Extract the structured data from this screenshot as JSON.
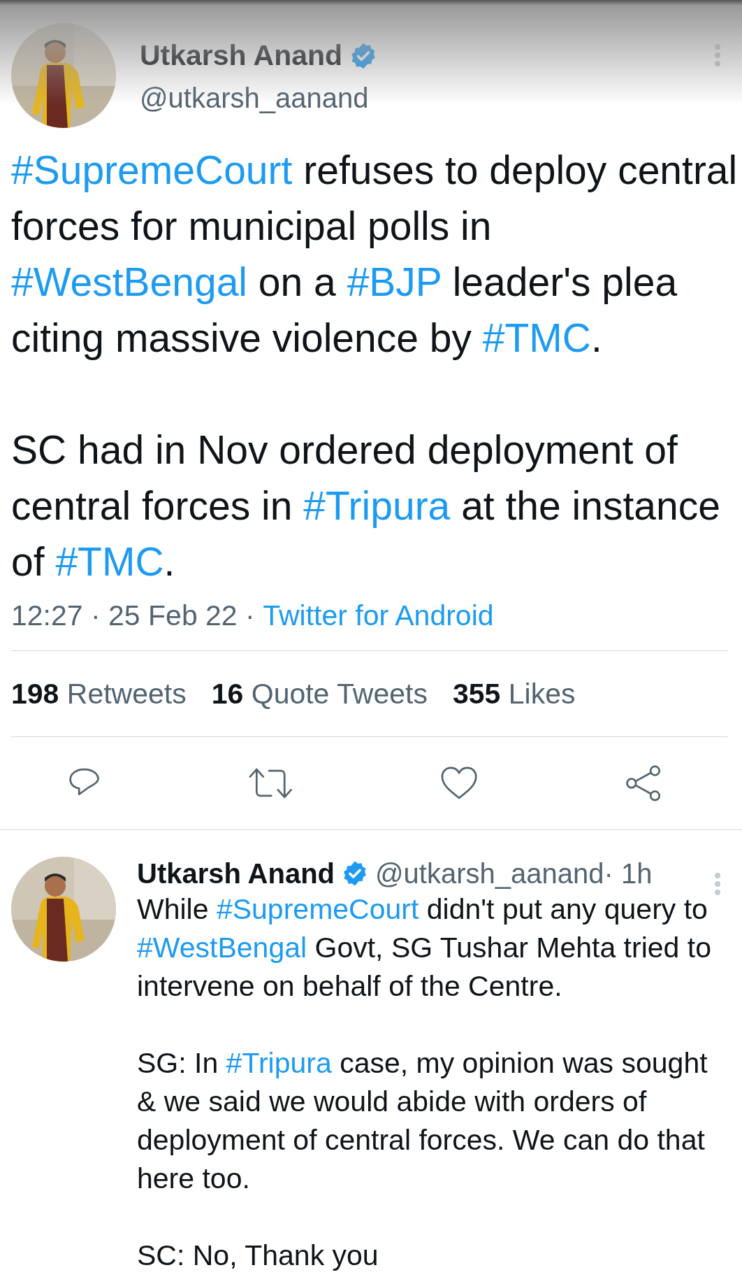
{
  "tweet": {
    "author": {
      "name": "Utkarsh Anand",
      "verified": true,
      "handle": "@utkarsh_aanand"
    },
    "paragraphs": [
      [
        {
          "kind": "hashtag",
          "text": "#SupremeCourt"
        },
        {
          "kind": "plain",
          "text": " refuses to deploy central forces for municipal polls in "
        },
        {
          "kind": "hashtag",
          "text": "#WestBengal"
        },
        {
          "kind": "plain",
          "text": " on a "
        },
        {
          "kind": "hashtag",
          "text": "#BJP"
        },
        {
          "kind": "plain",
          "text": " leader's plea citing massive violence by "
        },
        {
          "kind": "hashtag",
          "text": "#TMC"
        },
        {
          "kind": "plain",
          "text": "."
        }
      ],
      [
        {
          "kind": "plain",
          "text": "SC had in Nov ordered deployment of central forces in "
        },
        {
          "kind": "hashtag",
          "text": "#Tripura"
        },
        {
          "kind": "plain",
          "text": " at the instance of "
        },
        {
          "kind": "hashtag",
          "text": "#TMC"
        },
        {
          "kind": "plain",
          "text": "."
        }
      ]
    ],
    "time": "12:27 · 25 Feb 22 · ",
    "source": "Twitter for Android",
    "stats": [
      {
        "count": "198",
        "label": "Retweets"
      },
      {
        "count": "16",
        "label": "Quote Tweets"
      },
      {
        "count": "355",
        "label": "Likes"
      }
    ],
    "actions": [
      {
        "kind": "reply"
      },
      {
        "kind": "retweet"
      },
      {
        "kind": "like"
      },
      {
        "kind": "share"
      }
    ]
  },
  "reply": {
    "author": {
      "name": "Utkarsh Anand",
      "verified": true,
      "handle": "@utkarsh_aanand"
    },
    "age": " · 1h",
    "paragraphs": [
      [
        {
          "kind": "plain",
          "text": "While "
        },
        {
          "kind": "hashtag",
          "text": "#SupremeCourt"
        },
        {
          "kind": "plain",
          "text": " didn't put any query to "
        },
        {
          "kind": "hashtag",
          "text": "#WestBengal"
        },
        {
          "kind": "plain",
          "text": " Govt, SG Tushar Mehta tried to intervene on behalf of the Centre."
        }
      ],
      [
        {
          "kind": "plain",
          "text": "SG: In "
        },
        {
          "kind": "hashtag",
          "text": "#Tripura"
        },
        {
          "kind": "plain",
          "text": " case, my opinion was sought & we said we would abide with orders of deployment of central forces. We can do that here too."
        }
      ],
      [
        {
          "kind": "plain",
          "text": "SC: No, Thank you"
        }
      ]
    ]
  }
}
